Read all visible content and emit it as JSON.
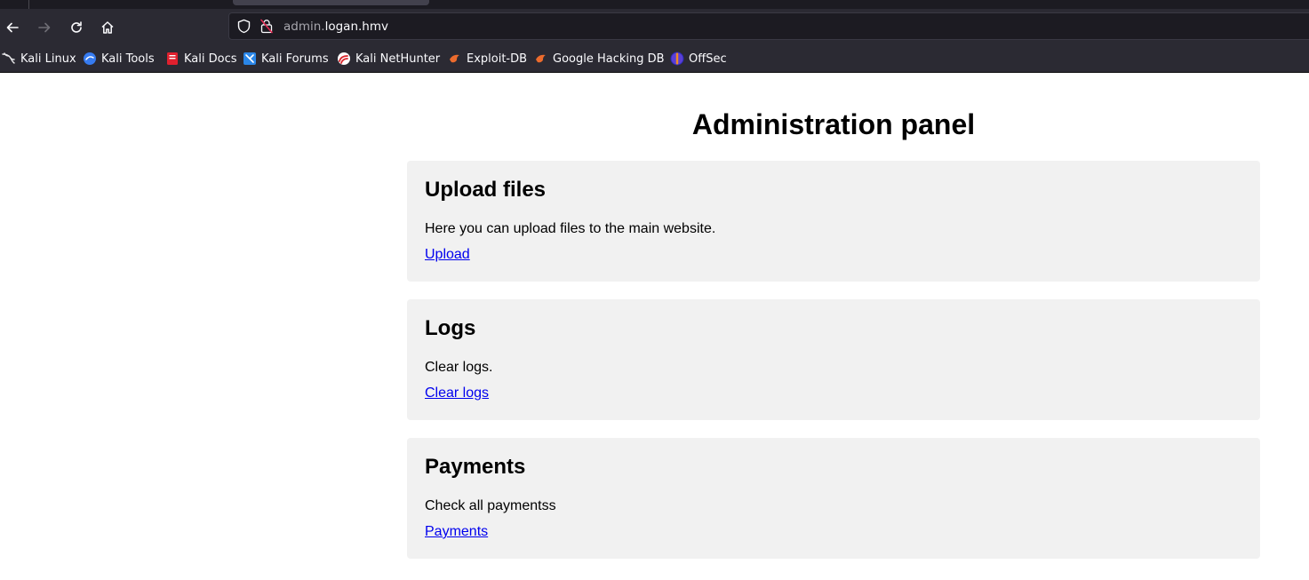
{
  "browser": {
    "url_subdomain": "admin.",
    "url_domain": "logan.hmv",
    "icons": {
      "back": "back-arrow-icon",
      "forward": "forward-arrow-icon",
      "reload": "reload-icon",
      "home": "home-icon",
      "tracking": "shield-icon",
      "insecure": "insecure-lock-icon"
    },
    "bookmarks": [
      {
        "label": "Kali Linux",
        "icon": "kali-dragon-icon"
      },
      {
        "label": "Kali Tools",
        "icon": "kali-tools-icon"
      },
      {
        "label": "Kali Docs",
        "icon": "kali-docs-icon"
      },
      {
        "label": "Kali Forums",
        "icon": "kali-forums-icon"
      },
      {
        "label": "Kali NetHunter",
        "icon": "nethunter-icon"
      },
      {
        "label": "Exploit-DB",
        "icon": "exploit-db-icon"
      },
      {
        "label": "Google Hacking DB",
        "icon": "ghdb-icon"
      },
      {
        "label": "OffSec",
        "icon": "offsec-icon"
      }
    ],
    "colors": {
      "chrome_bg": "#2b2a33",
      "urlbar_bg": "#1c1b22",
      "text": "#fbfbfe"
    }
  },
  "page": {
    "title": "Administration panel",
    "sections": [
      {
        "heading": "Upload files",
        "description": "Here you can upload files to the main website.",
        "link": "Upload"
      },
      {
        "heading": "Logs",
        "description": "Clear logs.",
        "link": "Clear logs"
      },
      {
        "heading": "Payments",
        "description": "Check all paymentss",
        "link": "Payments"
      }
    ],
    "colors": {
      "card_bg": "#f1f1f1",
      "link": "#0000ee"
    }
  }
}
